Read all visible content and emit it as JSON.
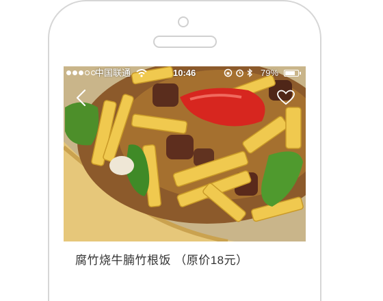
{
  "status_bar": {
    "signal_dots_filled": 3,
    "signal_dots_total": 5,
    "carrier": "中国联通",
    "time": "10:46",
    "battery_percent_label": "79%",
    "battery_level": 0.79,
    "icons": [
      "wifi-icon",
      "orientation-lock-icon",
      "alarm-icon",
      "bluetooth-icon",
      "battery-icon"
    ]
  },
  "nav": {
    "back_icon": "chevron-left-icon",
    "favorite_icon": "heart-outline-icon"
  },
  "dish": {
    "photo": "food-photo",
    "caption": "腐竹烧牛腩竹根饭 （原价18元）"
  },
  "colors": {
    "status_text": "#ffffff",
    "caption_text": "#333333",
    "device_outline": "#d6d6d6"
  }
}
